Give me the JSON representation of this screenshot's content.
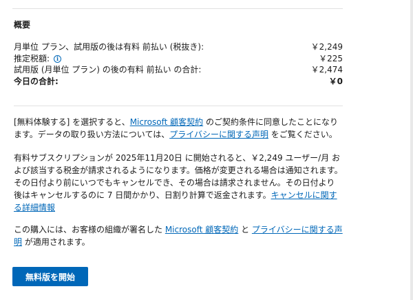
{
  "summary": {
    "title": "概要",
    "rows": [
      {
        "label": "月単位 プラン、試用版の後は有料 前払い (税抜き):",
        "amount": "￥2,249"
      },
      {
        "label": "推定税額:",
        "amount": "￥225"
      },
      {
        "label": "試用版 (月単位 プラン) の後の有料 前払い の合計:",
        "amount": "￥2,474"
      },
      {
        "label": "今日の合計:",
        "amount": "￥0"
      }
    ],
    "info_icon": "info-icon"
  },
  "terms": {
    "p1_a": "[無料体験する] を選択すると、",
    "p1_link1": "Microsoft 顧客契約",
    "p1_b": " のご契約条件に同意したことになります。データの取り扱い方法については、",
    "p1_link2": "プライバシーに関する声明",
    "p1_c": " をご覧ください。",
    "p2_a": "有料サブスクリプションが 2025年11月20日 に開始されると、￥2,249 ユーザー/月 および該当する税金が請求されるようになります。価格が変更される場合は通知されます。その日付より前にいつでもキャンセルでき、その場合は請求されません。その日付より後はキャンセルするのに 7 日間かかり、日割り計算で返金されます。",
    "p2_link": "キャンセルに関する詳細情報",
    "p3_a": "この購入には、お客様の組織が署名した ",
    "p3_link1": "Microsoft 顧客契約",
    "p3_b": " と ",
    "p3_link2": "プライバシーに関する声明",
    "p3_c": " が適用されます。"
  },
  "actions": {
    "start_label": "無料版を開始"
  },
  "colors": {
    "accent": "#0067b8"
  }
}
